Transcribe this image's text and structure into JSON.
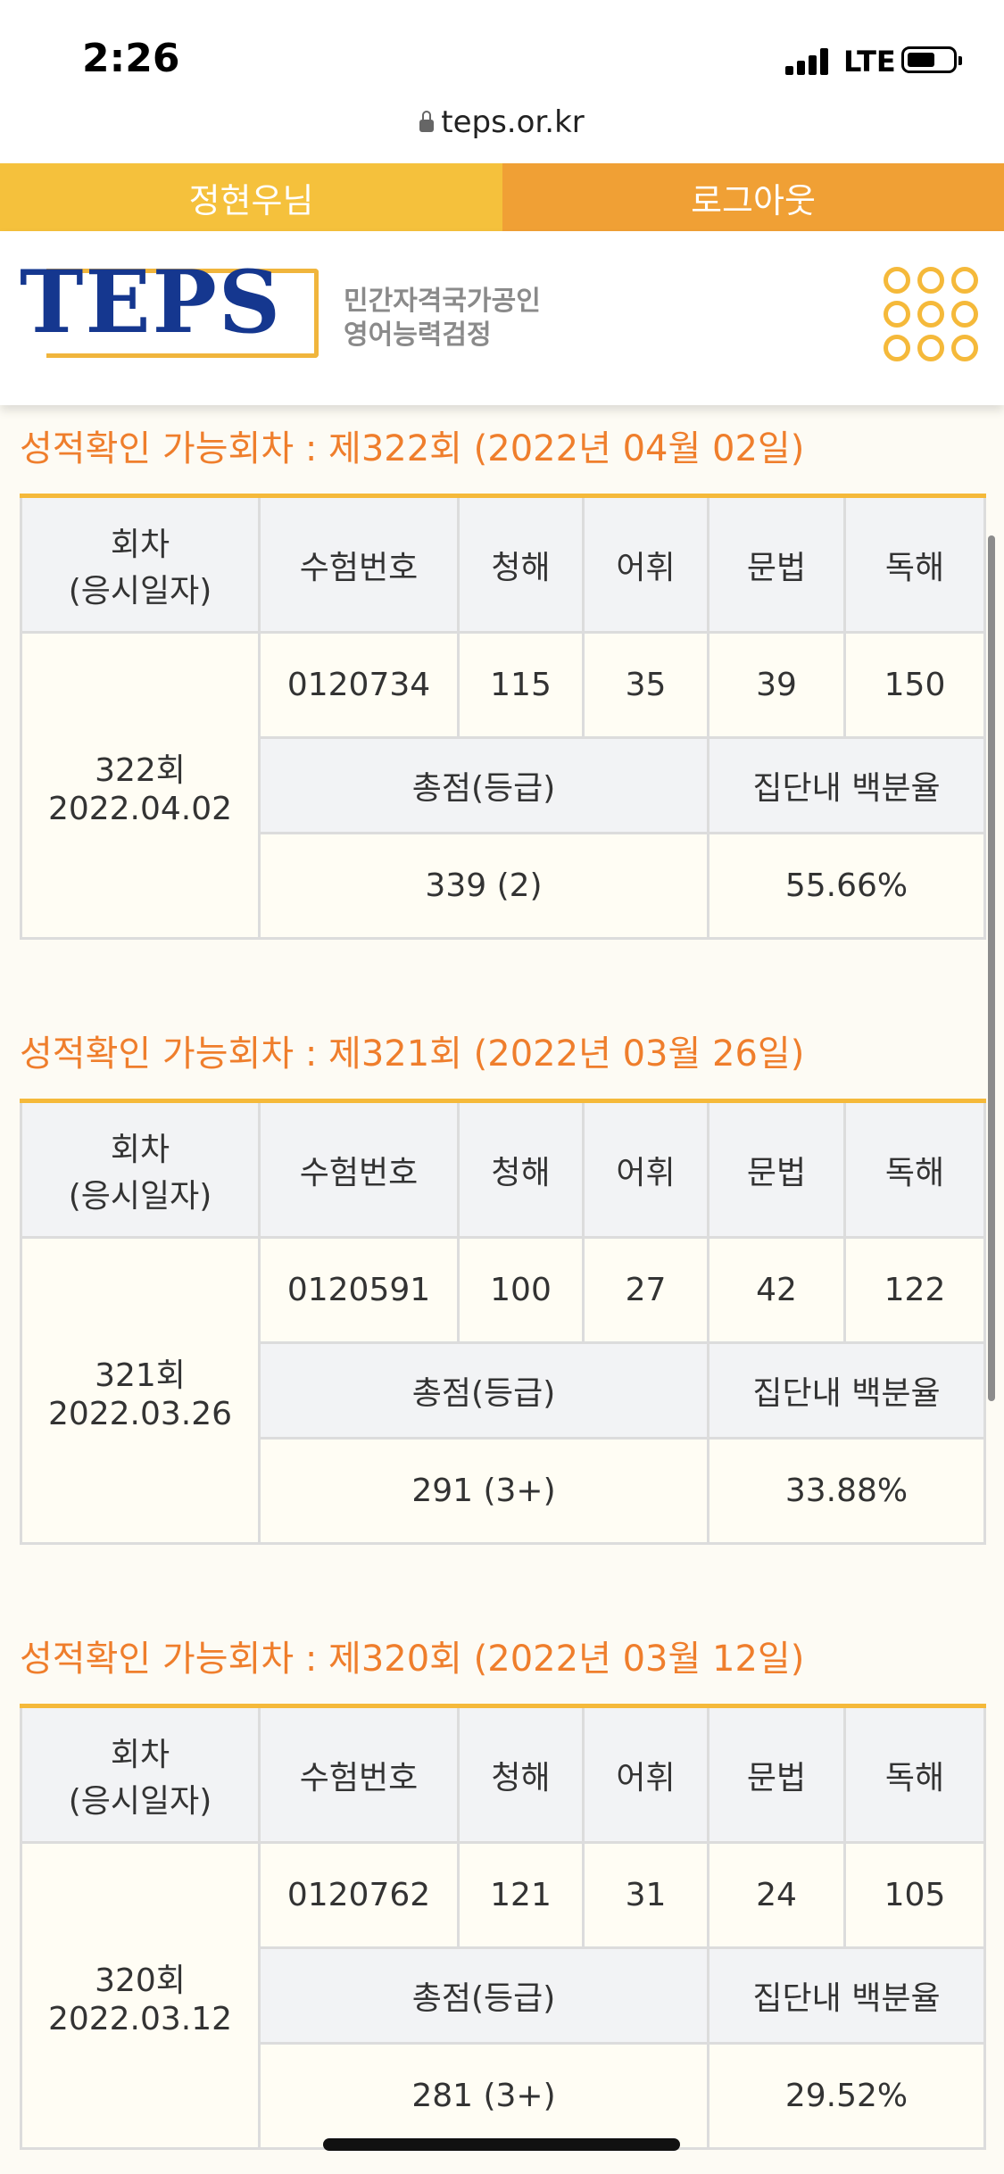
{
  "status_bar": {
    "time": "2:26",
    "network": "LTE"
  },
  "browser": {
    "url": "teps.or.kr"
  },
  "nav": {
    "user_label": "정현우님",
    "logout_label": "로그아웃"
  },
  "header": {
    "logo_text": "TEPS",
    "subtitle_line1": "민간자격국가공인",
    "subtitle_line2": "영어능력검정"
  },
  "table_headers": {
    "round": "회차",
    "round_sub": "(응시일자)",
    "exam_number": "수험번호",
    "listening": "청해",
    "vocabulary": "어휘",
    "grammar": "문법",
    "reading": "독해",
    "total": "총점(등급)",
    "percentile": "집단내 백분율"
  },
  "sessions": [
    {
      "title": "성적확인 가능회차 : 제322회 (2022년 04월 02일)",
      "round": "322회",
      "date": "2022.04.02",
      "exam_number": "0120734",
      "listening": "115",
      "vocabulary": "35",
      "grammar": "39",
      "reading": "150",
      "total": "339 (2)",
      "percentile": "55.66%"
    },
    {
      "title": "성적확인 가능회차 : 제321회 (2022년 03월 26일)",
      "round": "321회",
      "date": "2022.03.26",
      "exam_number": "0120591",
      "listening": "100",
      "vocabulary": "27",
      "grammar": "42",
      "reading": "122",
      "total": "291 (3+)",
      "percentile": "33.88%"
    },
    {
      "title": "성적확인 가능회차 : 제320회 (2022년 03월 12일)",
      "round": "320회",
      "date": "2022.03.12",
      "exam_number": "0120762",
      "listening": "121",
      "vocabulary": "31",
      "grammar": "24",
      "reading": "105",
      "total": "281 (3+)",
      "percentile": "29.52%"
    }
  ]
}
